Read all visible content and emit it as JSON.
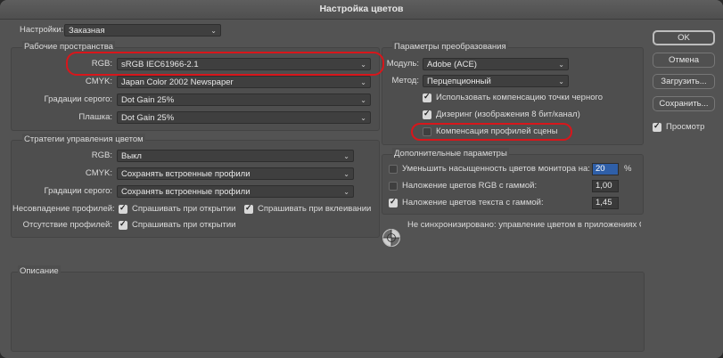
{
  "window": {
    "title": "Настройка цветов"
  },
  "settings": {
    "label": "Настройки:",
    "value": "Заказная"
  },
  "working_spaces": {
    "title": "Рабочие пространства",
    "rgb": {
      "label": "RGB:",
      "value": "sRGB IEC61966-2.1"
    },
    "cmyk": {
      "label": "CMYK:",
      "value": "Japan Color 2002 Newspaper"
    },
    "gray": {
      "label": "Градации серого:",
      "value": "Dot Gain 25%"
    },
    "spot": {
      "label": "Плашка:",
      "value": "Dot Gain 25%"
    }
  },
  "policies": {
    "title": "Стратегии управления цветом",
    "rgb": {
      "label": "RGB:",
      "value": "Выкл"
    },
    "cmyk": {
      "label": "CMYK:",
      "value": "Сохранять встроенные профили"
    },
    "gray": {
      "label": "Градации серого:",
      "value": "Сохранять встроенные профили"
    },
    "mismatch": {
      "label": "Несовпадение профилей:",
      "ask_open": "Спрашивать при открытии",
      "ask_paste": "Спрашивать при вклеивании"
    },
    "missing": {
      "label": "Отсутствие профилей:",
      "ask_open": "Спрашивать при открытии"
    }
  },
  "conversion": {
    "title": "Параметры преобразования",
    "engine": {
      "label": "Модуль:",
      "value": "Adobe (ACE)"
    },
    "intent": {
      "label": "Метод:",
      "value": "Перцепционный"
    },
    "black_point": {
      "label": "Использовать компенсацию точки черного",
      "checked": true
    },
    "dither": {
      "label": "Дизеринг (изображения 8 бит/канал)",
      "checked": true
    },
    "scene": {
      "label": "Компенсация профилей сцены",
      "checked": false
    }
  },
  "advanced": {
    "title": "Дополнительные параметры",
    "desaturate": {
      "label": "Уменьшить насыщенность цветов монитора на:",
      "value": "20",
      "unit": "%",
      "checked": false
    },
    "blend_rgb": {
      "label": "Наложение цветов RGB с гаммой:",
      "value": "1,00",
      "checked": false
    },
    "blend_text": {
      "label": "Наложение цветов текста с гаммой:",
      "value": "1,45",
      "checked": true
    },
    "status": "Не синхронизировано: управление цветом в приложениях Cre..."
  },
  "description": {
    "title": "Описание"
  },
  "buttons": {
    "ok": "OK",
    "cancel": "Отмена",
    "load": "Загрузить...",
    "save": "Сохранить...",
    "preview": "Просмотр"
  },
  "colors": {
    "highlight_ring": "#d8161b",
    "field_highlight": "#2f5fa8"
  }
}
